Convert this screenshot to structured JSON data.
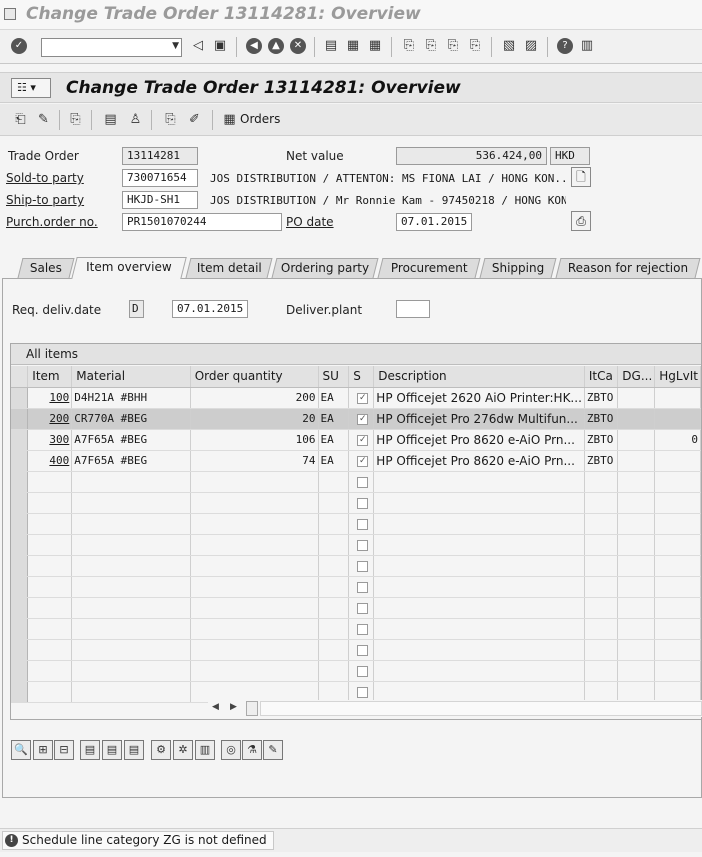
{
  "window": {
    "title": "Change Trade Order 13114281: Overview"
  },
  "app": {
    "title": "Change Trade Order 13114281: Overview",
    "orders_label": "Orders"
  },
  "header": {
    "trade_order_label": "Trade Order",
    "trade_order": "13114281",
    "net_value_label": "Net value",
    "net_value": "536.424,00",
    "currency": "HKD",
    "sold_to_label": "Sold-to party",
    "sold_to": "730071654",
    "sold_to_name": "JOS DISTRIBUTION / ATTENTON: MS FIONA LAI / HONG KON...",
    "ship_to_label": "Ship-to party",
    "ship_to": "HKJD-SH1",
    "ship_to_name": "JOS DISTRIBUTION / Mr Ronnie Kam - 97450218 / HONG KON...",
    "po_label": "Purch.order no.",
    "po": "PR1501070244",
    "po_date_label": "PO date",
    "po_date": "07.01.2015"
  },
  "tabs": [
    "Sales",
    "Item overview",
    "Item detail",
    "Ordering party",
    "Procurement",
    "Shipping",
    "Reason for rejection"
  ],
  "active_tab": "Item overview",
  "overview": {
    "req_deliv_label": "Req. deliv.date",
    "req_deliv_type": "D",
    "req_deliv_date": "07.01.2015",
    "deliver_plant_label": "Deliver.plant",
    "deliver_plant": ""
  },
  "items": {
    "title": "All items",
    "columns": [
      "Item",
      "Material",
      "Order quantity",
      "SU",
      "S",
      "Description",
      "ItCa",
      "DG...",
      "HgLvIt"
    ],
    "rows": [
      {
        "item": "100",
        "material": "D4H21A   #BHH",
        "qty": "200",
        "su": "EA",
        "checked": true,
        "desc": "HP Officejet 2620 AiO Printer:HK...",
        "itca": "ZBTO",
        "dg": "",
        "hglvit": ""
      },
      {
        "item": "200",
        "material": "CR770A   #BEG",
        "qty": "20",
        "su": "EA",
        "checked": true,
        "desc": "HP Officejet Pro 276dw Multifun...",
        "itca": "ZBTO",
        "dg": "",
        "hglvit": ""
      },
      {
        "item": "300",
        "material": "A7F65A   #BEG",
        "qty": "106",
        "su": "EA",
        "checked": true,
        "desc": "HP Officejet Pro 8620 e-AiO Prn...",
        "itca": "ZBTO",
        "dg": "",
        "hglvit": "0"
      },
      {
        "item": "400",
        "material": "A7F65A   #BEG",
        "qty": "74",
        "su": "EA",
        "checked": true,
        "desc": "HP Officejet Pro 8620 e-AiO Prn...",
        "itca": "ZBTO",
        "dg": "",
        "hglvit": ""
      }
    ],
    "empty_rows": 11
  },
  "status": {
    "message": "Schedule line category ZG is not defined"
  }
}
